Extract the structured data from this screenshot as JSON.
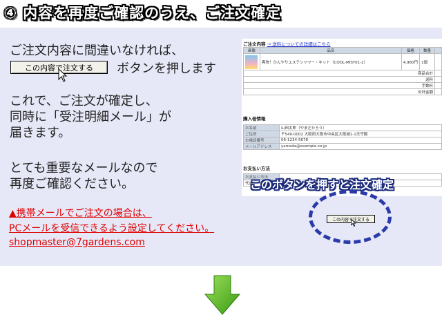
{
  "header": {
    "title": "④ 内容を再度ご確認のうえ、ご注文確定"
  },
  "instructions": {
    "line1": "ご注文内容に間違いなければ、",
    "button_label": "この内容で注文する",
    "button_suffix": "ボタンを押します",
    "para2": [
      "これで、ご注文が確定し、",
      "同時に「受注明細メール」が",
      "届きます。"
    ],
    "para3": [
      "とても重要なメールなので",
      "再度ご確認ください。"
    ]
  },
  "warning": {
    "line1": "▲携帯メールでご注文の場合は、",
    "line2": "PCメールを受信できるよう設定してください。",
    "email": "shopmaster@7gardens.com"
  },
  "screenshot": {
    "order_section": "ご注文内容",
    "order_link": "→ 送料についての詳細はこちら",
    "columns": [
      "画像",
      "品名",
      "価格",
      "数量"
    ],
    "item": {
      "name": "爽快！ひんやりエステシャワー・キット（COOL-MIST01-2）",
      "price": "4,980円",
      "qty": "1個"
    },
    "summary": [
      "商品合計",
      "送料",
      "手数料",
      "合計金額"
    ],
    "buyer_section": "購入者情報",
    "buyer_rows": [
      {
        "label": "お名前",
        "value": "山田太郎（やまだたろう）"
      },
      {
        "label": "ご住所",
        "value": "〒540-0002 大阪府大阪市中央区大阪城1-1天守閣"
      },
      {
        "label": "お電話番号",
        "value": "06-1234-5678"
      },
      {
        "label": "メールアドレス",
        "value": "yamada@example.co.jp"
      }
    ],
    "payment_section": "お支払い方法",
    "payment_row": "お支払い方法",
    "payment_value": "代金"
  },
  "callout": {
    "text": "このボタンを押すと注文確定"
  },
  "mini_button": {
    "label": "この内容で注文する"
  },
  "colors": {
    "panel_bg": "#e6e8f7",
    "warning": "#e00000",
    "ellipse": "#2a3aa8",
    "arrow": "#58b81f"
  }
}
